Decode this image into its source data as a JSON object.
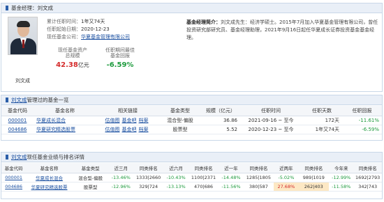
{
  "manager": {
    "header_label": "基金经理：",
    "name": "刘文成",
    "tenure_label": "累计任职时间：",
    "tenure_value": "1年又74天",
    "start_label": "任职起始日期：",
    "start_value": "2020-12-23",
    "company_label": "现任基金公司：",
    "company_value": "华夏基金管理有限公司",
    "scale_label_1": "现任基金资产",
    "scale_label_2": "总规模",
    "scale_value": "42.38",
    "scale_unit": "亿元",
    "return_label_1": "任职期间最佳",
    "return_label_2": "基金回报",
    "return_value": "-6.59%",
    "intro_label": "基金经理简介：",
    "intro_text": "刘文成先生：经济学硕士。2015年7月加入华夏基金管理有限公司，曾任投资研究部研究员、基金经理助理，2021年9月16日起任华夏成长证券投资基金基金经理。"
  },
  "funds_managed": {
    "header_name": "刘文成",
    "header_suffix": "管理过的基金一览",
    "columns": [
      "基金代码",
      "基金名称",
      "相关链接",
      "基金类型",
      "规模（亿元）",
      "任职时间",
      "任职天数",
      "任职回报"
    ],
    "rows": [
      {
        "code": "000001",
        "name": "华夏成长混合",
        "links": [
          "估值图",
          "基金吧",
          "档案"
        ],
        "type": "混合型-偏股",
        "scale": "36.86",
        "period": "2021-09-16 ~ 至今",
        "days": "172天",
        "return": "-11.61%"
      },
      {
        "code": "004686",
        "name": "华夏研究精选股票",
        "links": [
          "估值图",
          "基金吧",
          "档案"
        ],
        "type": "股票型",
        "scale": "5.52",
        "period": "2020-12-23 ~ 至今",
        "days": "1年又74天",
        "return": "-6.59%"
      }
    ]
  },
  "performance": {
    "header_name": "刘文成",
    "header_suffix": "现任基金业绩与排名详情",
    "columns": [
      "基金代码",
      "基金名称",
      "基金类型",
      "近三月",
      "同类排名",
      "近六月",
      "同类排名",
      "近一年",
      "同类排名",
      "近两年",
      "同类排名",
      "今年来",
      "同类排名"
    ],
    "rows": [
      {
        "code": "000001",
        "name": "华夏成长混合",
        "type": "混合型-偏股",
        "m3": "-13.46%",
        "m3r": "1333|2660",
        "m6": "-10.43%",
        "m6r": "1100|2371",
        "y1": "-14.48%",
        "y1r": "1285|1805",
        "y2": "-5.02%",
        "y2r": "989|1019",
        "ytd": "-12.99%",
        "ytdr": "1692|2793"
      },
      {
        "code": "004686",
        "name": "华夏研究精选股票",
        "type": "股票型",
        "m3": "-12.96%",
        "m3r": "329|724",
        "m6": "-13.13%",
        "m6r": "470|686",
        "y1": "-11.56%",
        "y1r": "380|587",
        "y2": "27.68%",
        "y2r": "262|403",
        "ytd": "-11.58%",
        "ytdr": "342|743"
      }
    ]
  }
}
